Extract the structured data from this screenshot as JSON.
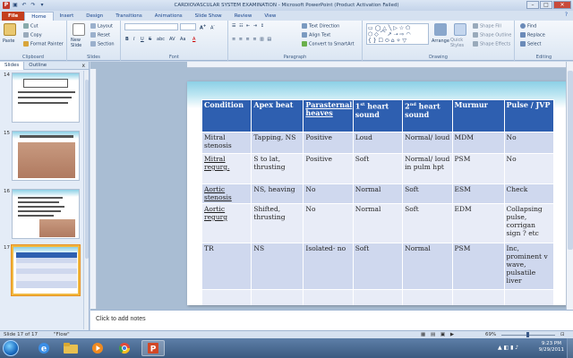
{
  "window": {
    "title": "CARDIOVASCULAR SYSTEM EXAMINATION  -  Microsoft PowerPoint (Product Activation Failed)",
    "app_icon": "P",
    "minimize": "–",
    "maximize": "□",
    "close": "✕"
  },
  "tabs": [
    "File",
    "Home",
    "Insert",
    "Design",
    "Transitions",
    "Animations",
    "Slide Show",
    "Review",
    "View"
  ],
  "ribbon": {
    "clipboard": {
      "label": "Clipboard",
      "paste": "Paste",
      "cut": "Cut",
      "copy": "Copy",
      "format_painter": "Format Painter"
    },
    "slides": {
      "label": "Slides",
      "new_slide": "New Slide",
      "layout": "Layout",
      "reset": "Reset",
      "section": "Section"
    },
    "font": {
      "label": "Font",
      "bold": "B",
      "italic": "I",
      "underline": "U",
      "strike": "S",
      "shadow": "abc",
      "spacing": "AV",
      "case": "Aa",
      "color": "A"
    },
    "paragraph": {
      "label": "Paragraph",
      "text_direction": "Text Direction",
      "align_text": "Align Text",
      "smartart": "Convert to SmartArt"
    },
    "drawing": {
      "label": "Drawing",
      "arrange": "Arrange",
      "quick_styles": "Quick Styles",
      "shape_fill": "Shape Fill",
      "shape_outline": "Shape Outline",
      "shape_effects": "Shape Effects"
    },
    "editing": {
      "label": "Editing",
      "find": "Find",
      "replace": "Replace",
      "select": "Select"
    }
  },
  "left_panel": {
    "tabs": [
      "Slides",
      "Outline"
    ],
    "close": "x",
    "slides": [
      {
        "num": "14"
      },
      {
        "num": "15"
      },
      {
        "num": "16"
      },
      {
        "num": "17"
      }
    ]
  },
  "table": {
    "headers": [
      {
        "text": "Condition",
        "underline": false
      },
      {
        "text": "Apex beat",
        "underline": false
      },
      {
        "text": "Parasternal heaves",
        "underline": true
      },
      {
        "text": "1st heart sound",
        "underline": false
      },
      {
        "text": "2nd heart sound",
        "underline": false
      },
      {
        "text": "Murmur",
        "underline": false
      },
      {
        "text": "Pulse / JVP",
        "underline": false
      }
    ],
    "rows": [
      [
        "Mitral stenosis",
        "Tapping, NS",
        "Positive",
        "Loud",
        "Normal/ loud",
        "MDM",
        "No"
      ],
      [
        "Mitral regurg.",
        "S to lat, thrusting",
        "Positive",
        "Soft",
        "Normal/ loud in pulm hpt",
        "PSM",
        "No"
      ],
      [
        "Aortic stenosis",
        "NS, heaving",
        "No",
        "Normal",
        "Soft",
        "ESM",
        "Check"
      ],
      [
        "Aortic regurg",
        "Shifted, thrusting",
        "No",
        "Normal",
        "Soft",
        "EDM",
        "Collapsing pulse, corrigan sign ? etc"
      ],
      [
        "TR",
        "NS",
        "Isolated- no",
        "Soft",
        "Normal",
        "PSM",
        "Inc, prominent v wave, pulsatile liver"
      ],
      [
        "",
        "",
        "",
        "",
        "",
        "",
        ""
      ]
    ]
  },
  "notes": {
    "placeholder": "Click to add notes"
  },
  "status": {
    "slide": "Slide 17 of 17",
    "theme": "\"Flow\"",
    "zoom": "69%"
  },
  "taskbar": {
    "time": "9:23 PM",
    "date": "9/29/2011"
  }
}
